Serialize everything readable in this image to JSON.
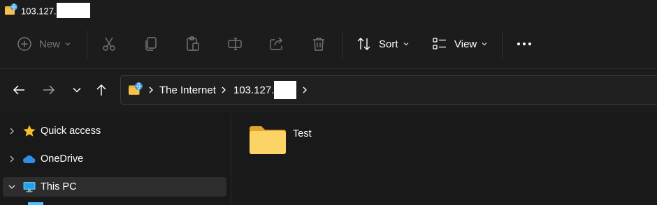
{
  "window": {
    "title": "103.127."
  },
  "toolbar": {
    "new_label": "New",
    "sort_label": "Sort",
    "view_label": "View",
    "icons": [
      "plus-circle-icon",
      "cut-icon",
      "copy-icon",
      "paste-icon",
      "rename-icon",
      "share-icon",
      "delete-icon",
      "sort-icon",
      "view-icon",
      "more-icon"
    ]
  },
  "address": {
    "crumbs": [
      "The Internet",
      "103.127."
    ]
  },
  "sidebar": {
    "items": [
      {
        "label": "Quick access",
        "icon": "star-icon"
      },
      {
        "label": "OneDrive",
        "icon": "cloud-icon"
      },
      {
        "label": "This PC",
        "icon": "monitor-icon",
        "selected": true
      }
    ]
  },
  "content": {
    "files": [
      {
        "name": "Test",
        "type": "folder"
      }
    ]
  },
  "colors": {
    "background": "#191919",
    "accent": "#4cc2ff",
    "folder": "#f8c24a"
  }
}
